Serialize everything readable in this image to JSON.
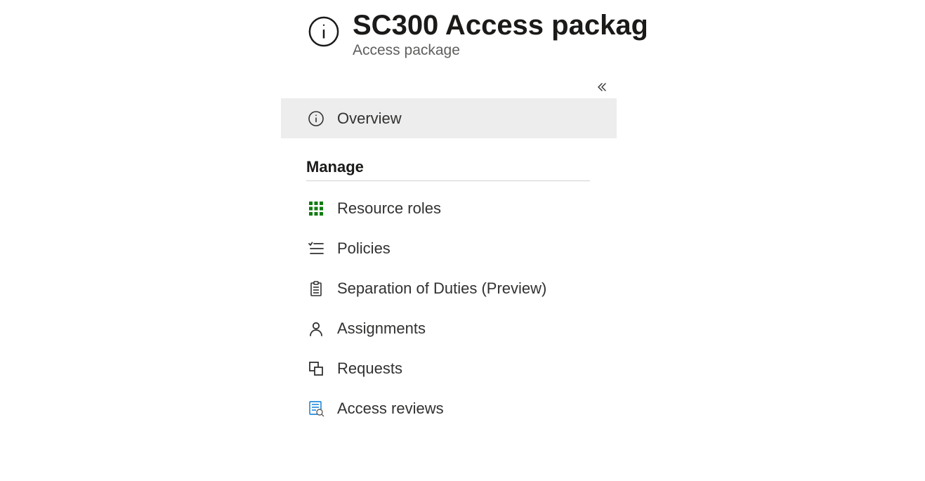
{
  "header": {
    "title": "SC300 Access packag",
    "subtitle": "Access package"
  },
  "nav": {
    "overview": "Overview",
    "section_manage": "Manage",
    "items": {
      "resource_roles": "Resource roles",
      "policies": "Policies",
      "separation_of_duties": "Separation of Duties (Preview)",
      "assignments": "Assignments",
      "requests": "Requests",
      "access_reviews": "Access reviews"
    }
  }
}
